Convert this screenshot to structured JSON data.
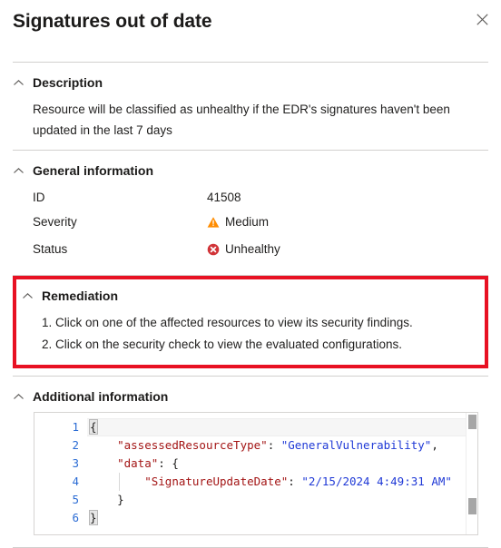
{
  "header": {
    "title": "Signatures out of date",
    "close_icon": "close-icon"
  },
  "sections": {
    "description": {
      "title": "Description",
      "text": "Resource will be classified as unhealthy if the EDR's signatures haven't been updated in the last 7 days"
    },
    "general_information": {
      "title": "General information",
      "rows": [
        {
          "label": "ID",
          "value": "41508",
          "icon": ""
        },
        {
          "label": "Severity",
          "value": "Medium",
          "icon": "warning-triangle-icon"
        },
        {
          "label": "Status",
          "value": "Unhealthy",
          "icon": "error-circle-icon"
        }
      ]
    },
    "remediation": {
      "title": "Remediation",
      "steps": [
        "1. Click on one of the affected resources to view its security findings.",
        "2. Click on the security check to view the evaluated configurations."
      ]
    },
    "additional_information": {
      "title": "Additional information",
      "code": {
        "line_numbers": [
          "1",
          "2",
          "3",
          "4",
          "5",
          "6"
        ],
        "lines": [
          {
            "n": "1",
            "segments": [
              {
                "t": "{",
                "c": "brace"
              }
            ]
          },
          {
            "n": "2",
            "segments": [
              {
                "t": "    ",
                "c": "plain"
              },
              {
                "t": "\"assessedResourceType\"",
                "c": "key"
              },
              {
                "t": ": ",
                "c": "punct"
              },
              {
                "t": "\"GeneralVulnerability\"",
                "c": "str"
              },
              {
                "t": ",",
                "c": "punct"
              }
            ]
          },
          {
            "n": "3",
            "segments": [
              {
                "t": "    ",
                "c": "plain"
              },
              {
                "t": "\"data\"",
                "c": "key"
              },
              {
                "t": ": {",
                "c": "punct"
              }
            ]
          },
          {
            "n": "4",
            "segments": [
              {
                "t": "        ",
                "c": "plain"
              },
              {
                "t": "\"SignatureUpdateDate\"",
                "c": "key"
              },
              {
                "t": ": ",
                "c": "punct"
              },
              {
                "t": "\"2/15/2024 4:49:31 AM\"",
                "c": "str"
              }
            ]
          },
          {
            "n": "5",
            "segments": [
              {
                "t": "    }",
                "c": "punct"
              }
            ]
          },
          {
            "n": "6",
            "segments": [
              {
                "t": "}",
                "c": "brace"
              }
            ]
          }
        ]
      }
    }
  },
  "colors": {
    "highlight_border": "#e81123",
    "severity_medium": "#ff8c00",
    "status_unhealthy": "#d13438",
    "line_number": "#2b6cd4",
    "json_key": "#a31515",
    "json_string": "#1f39d6"
  }
}
